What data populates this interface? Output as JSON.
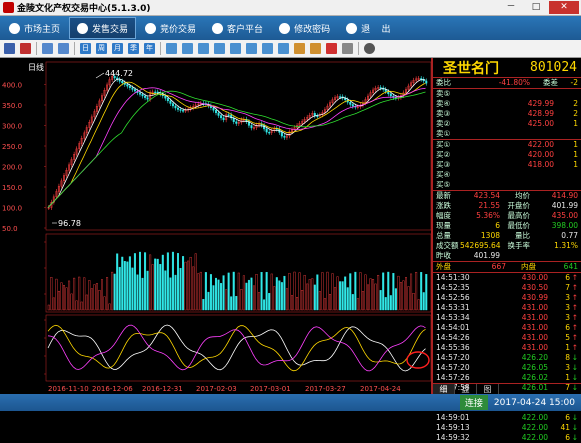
{
  "window": {
    "title": "金陵文化产权交易中心(5.1.3.0)",
    "min": "－",
    "max": "□",
    "close": "✕"
  },
  "nav": [
    {
      "label": "市场主页",
      "icon": "home-icon"
    },
    {
      "label": "发售交易",
      "icon": "trade-icon",
      "active": true
    },
    {
      "label": "竞价交易",
      "icon": "bid-icon"
    },
    {
      "label": "客户平台",
      "icon": "client-icon"
    },
    {
      "label": "修改密码",
      "icon": "key-icon"
    },
    {
      "label": "退",
      "icon": "exit-icon"
    },
    {
      "label": "出",
      "icon": ""
    }
  ],
  "toolbar": {
    "buttons": [
      "日",
      "周",
      "月",
      "季",
      "年"
    ]
  },
  "chart": {
    "period_label": "日线",
    "y_ticks": [
      "400.0",
      "350.0",
      "300.0",
      "250.0",
      "200.0",
      "150.0",
      "100.0",
      "50.0"
    ],
    "high_label": "444.72",
    "low_label": "96.78",
    "x_ticks": [
      "2016-11-10",
      "2016-12-06",
      "2016-12-31",
      "2017-02-03",
      "2017-03-01",
      "2017-03-27",
      "2017-04-24"
    ]
  },
  "chart_data": {
    "type": "candlestick",
    "ylim": [
      50,
      450
    ],
    "high": 444.72,
    "low": 96.78
  },
  "stock": {
    "name": "圣世名门",
    "code": "801024"
  },
  "order_book": {
    "ratio_label": "委比",
    "ratio_value": "-41.80%",
    "diff_label": "委差",
    "diff_value": "-2",
    "asks": [
      {
        "label": "卖⑤",
        "price": "",
        "qty": ""
      },
      {
        "label": "卖④",
        "price": "429.99",
        "qty": "2"
      },
      {
        "label": "卖③",
        "price": "428.99",
        "qty": "2"
      },
      {
        "label": "卖②",
        "price": "425.00",
        "qty": "1"
      },
      {
        "label": "卖①",
        "price": "",
        "qty": ""
      }
    ],
    "bids": [
      {
        "label": "买①",
        "price": "422.00",
        "qty": "1"
      },
      {
        "label": "买②",
        "price": "420.00",
        "qty": "1"
      },
      {
        "label": "买③",
        "price": "418.00",
        "qty": "1"
      },
      {
        "label": "买④",
        "price": "",
        "qty": ""
      },
      {
        "label": "买⑤",
        "price": "",
        "qty": ""
      }
    ]
  },
  "quote": [
    {
      "l1": "最新",
      "v1": "423.54",
      "c1": "red",
      "l2": "均价",
      "v2": "414.90",
      "c2": "red"
    },
    {
      "l1": "涨跌",
      "v1": "21.55",
      "c1": "red",
      "l2": "开盘价",
      "v2": "401.99",
      "c2": "wht"
    },
    {
      "l1": "幅度",
      "v1": "5.36%",
      "c1": "red",
      "l2": "最高价",
      "v2": "435.00",
      "c2": "red"
    },
    {
      "l1": "现量",
      "v1": "6",
      "c1": "yel",
      "l2": "最低价",
      "v2": "398.00",
      "c2": "grn"
    },
    {
      "l1": "总量",
      "v1": "1308",
      "c1": "yel",
      "l2": "量比",
      "v2": "0.77",
      "c2": "wht"
    },
    {
      "l1": "成交额",
      "v1": "542695.64",
      "c1": "yel",
      "l2": "换手率",
      "v2": "1.31%",
      "c2": "yel"
    },
    {
      "l1": "昨收",
      "v1": "401.99",
      "c1": "wht",
      "l2": "",
      "v2": "",
      "c2": "wht"
    }
  ],
  "volume_split": {
    "out_label": "外盘",
    "out_value": "667",
    "in_label": "内盘",
    "in_value": "641"
  },
  "ticks": [
    {
      "time": "14:51:30",
      "price": "430.00",
      "qty": "6",
      "dir": "up"
    },
    {
      "time": "14:52:35",
      "price": "430.50",
      "qty": "7",
      "dir": "up"
    },
    {
      "time": "14:52:56",
      "price": "430.99",
      "qty": "3",
      "dir": "up"
    },
    {
      "time": "14:53:31",
      "price": "431.00",
      "qty": "3",
      "dir": "up"
    },
    {
      "time": "14:53:34",
      "price": "431.00",
      "qty": "3",
      "dir": "up"
    },
    {
      "time": "14:54:01",
      "price": "431.00",
      "qty": "6",
      "dir": "up"
    },
    {
      "time": "14:54:26",
      "price": "431.00",
      "qty": "5",
      "dir": "up"
    },
    {
      "time": "14:55:36",
      "price": "431.00",
      "qty": "1",
      "dir": "up"
    },
    {
      "time": "14:57:20",
      "price": "426.20",
      "qty": "8",
      "dir": "down"
    },
    {
      "time": "14:57:20",
      "price": "426.05",
      "qty": "3",
      "dir": "down"
    },
    {
      "time": "14:57:26",
      "price": "426.02",
      "qty": "1",
      "dir": "down"
    },
    {
      "time": "14:57:58",
      "price": "426.01",
      "qty": "7",
      "dir": "down"
    },
    {
      "time": "14:58:20",
      "price": "425.01",
      "qty": "6",
      "dir": "down"
    },
    {
      "time": "14:58:36",
      "price": "425.01",
      "qty": "1",
      "dir": "down"
    },
    {
      "time": "14:59:01",
      "price": "422.00",
      "qty": "6",
      "dir": "down"
    },
    {
      "time": "14:59:13",
      "price": "422.00",
      "qty": "41",
      "dir": "down"
    },
    {
      "time": "14:59:32",
      "price": "422.00",
      "qty": "6",
      "dir": "down"
    }
  ],
  "bottom_tabs": [
    "细",
    "盘",
    "图"
  ],
  "status": {
    "connection": "连接",
    "datetime": "2017-04-24 15:00"
  }
}
